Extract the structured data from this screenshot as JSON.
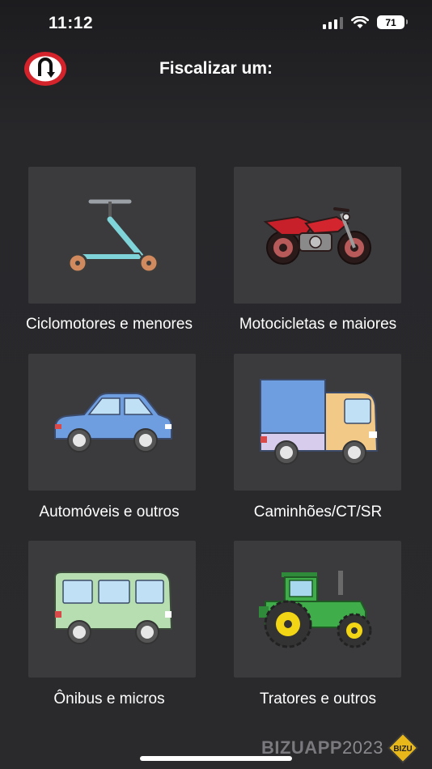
{
  "status_bar": {
    "time": "11:12",
    "battery": "71",
    "icons": [
      "signal-icon",
      "wifi-icon",
      "battery-icon"
    ]
  },
  "header": {
    "title": "Fiscalizar um:",
    "back_icon": "u-turn-prohibited-sign-icon"
  },
  "vehicles": [
    {
      "label": "Ciclomotores e menores",
      "icon": "scooter-icon"
    },
    {
      "label": "Motocicletas e maiores",
      "icon": "motorcycle-icon"
    },
    {
      "label": "Automóveis e outros",
      "icon": "car-icon"
    },
    {
      "label": "Caminhões/CT/SR",
      "icon": "truck-icon"
    },
    {
      "label": "Ônibus e micros",
      "icon": "bus-icon"
    },
    {
      "label": "Tratores e outros",
      "icon": "tractor-icon"
    }
  ],
  "watermark": {
    "brand": "BIZUAPP",
    "year": "2023",
    "logo_text": "BIZU"
  },
  "colors": {
    "background": "#28282b",
    "tile": "#3b3b3d",
    "text": "#ffffff",
    "sign_red": "#d4232a"
  }
}
